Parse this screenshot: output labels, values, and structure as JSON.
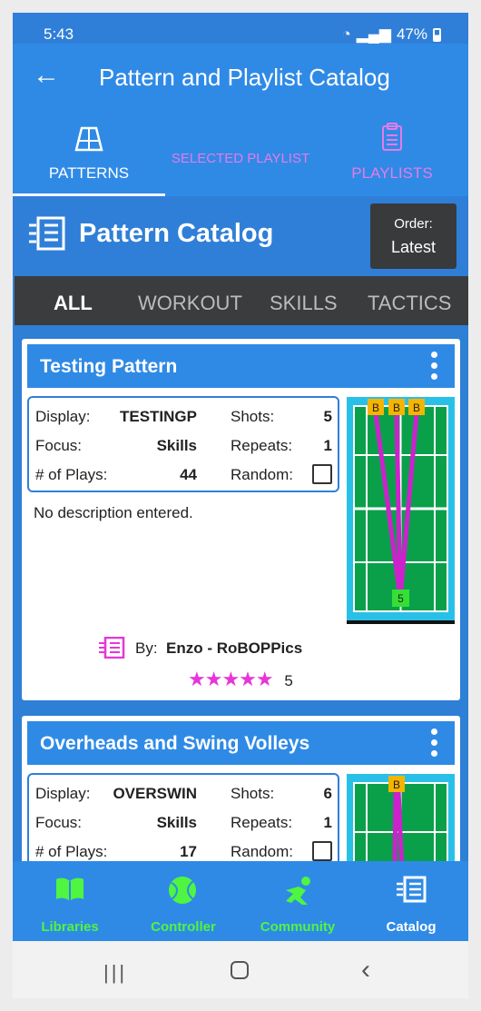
{
  "status_bar": {
    "time": "5:43",
    "battery": "47%"
  },
  "app_bar": {
    "back_icon": "arrow-left-icon",
    "title": "Pattern and Playlist Catalog"
  },
  "tabs": [
    {
      "label": "PATTERNS",
      "icon": "court-icon",
      "active": true
    },
    {
      "label": "SELECTED PLAYLIST",
      "active": false
    },
    {
      "label": "PLAYLISTS",
      "icon": "clipboard-icon",
      "active": false
    }
  ],
  "catalog": {
    "title": "Pattern Catalog",
    "order_label": "Order:",
    "order_value": "Latest"
  },
  "filters": [
    "ALL",
    "WORKOUT",
    "SKILLS",
    "TACTICS"
  ],
  "patterns": [
    {
      "title": "Testing Pattern",
      "display_label": "Display:",
      "display": "TESTINGP",
      "focus_label": "Focus:",
      "focus": "Skills",
      "plays_label": "# of Plays:",
      "plays": "44",
      "shots_label": "Shots:",
      "shots": "5",
      "repeats_label": "Repeats:",
      "repeats": "1",
      "random_label": "Random:",
      "random": false,
      "description": "No description entered.",
      "by_label": "By:",
      "author": "Enzo - RoBOPPics",
      "stars": "★★★★★",
      "rating": "5",
      "court_labels": [
        "B",
        "B",
        "B",
        "5"
      ]
    },
    {
      "title": "Overheads and Swing Volleys",
      "display_label": "Display:",
      "display": "OVERSWIN",
      "focus_label": "Focus:",
      "focus": "Skills",
      "plays_label": "# of Plays:",
      "plays": "17",
      "shots_label": "Shots:",
      "shots": "6",
      "repeats_label": "Repeats:",
      "repeats": "1",
      "random_label": "Random:",
      "random": false,
      "court_labels": [
        "B"
      ]
    }
  ],
  "bottom_nav": [
    {
      "label": "Libraries",
      "icon": "book-icon",
      "color": "#4ff540"
    },
    {
      "label": "Controller",
      "icon": "tennis-ball-icon",
      "color": "#4ff540"
    },
    {
      "label": "Community",
      "icon": "player-icon",
      "color": "#4ff540"
    },
    {
      "label": "Catalog",
      "icon": "catalog-icon",
      "color": "#ffffff",
      "active": true
    }
  ],
  "colors": {
    "primary": "#2f8ae6",
    "accent": "#e636d8",
    "nav_green": "#4ff540",
    "court": "#0aa04a"
  }
}
